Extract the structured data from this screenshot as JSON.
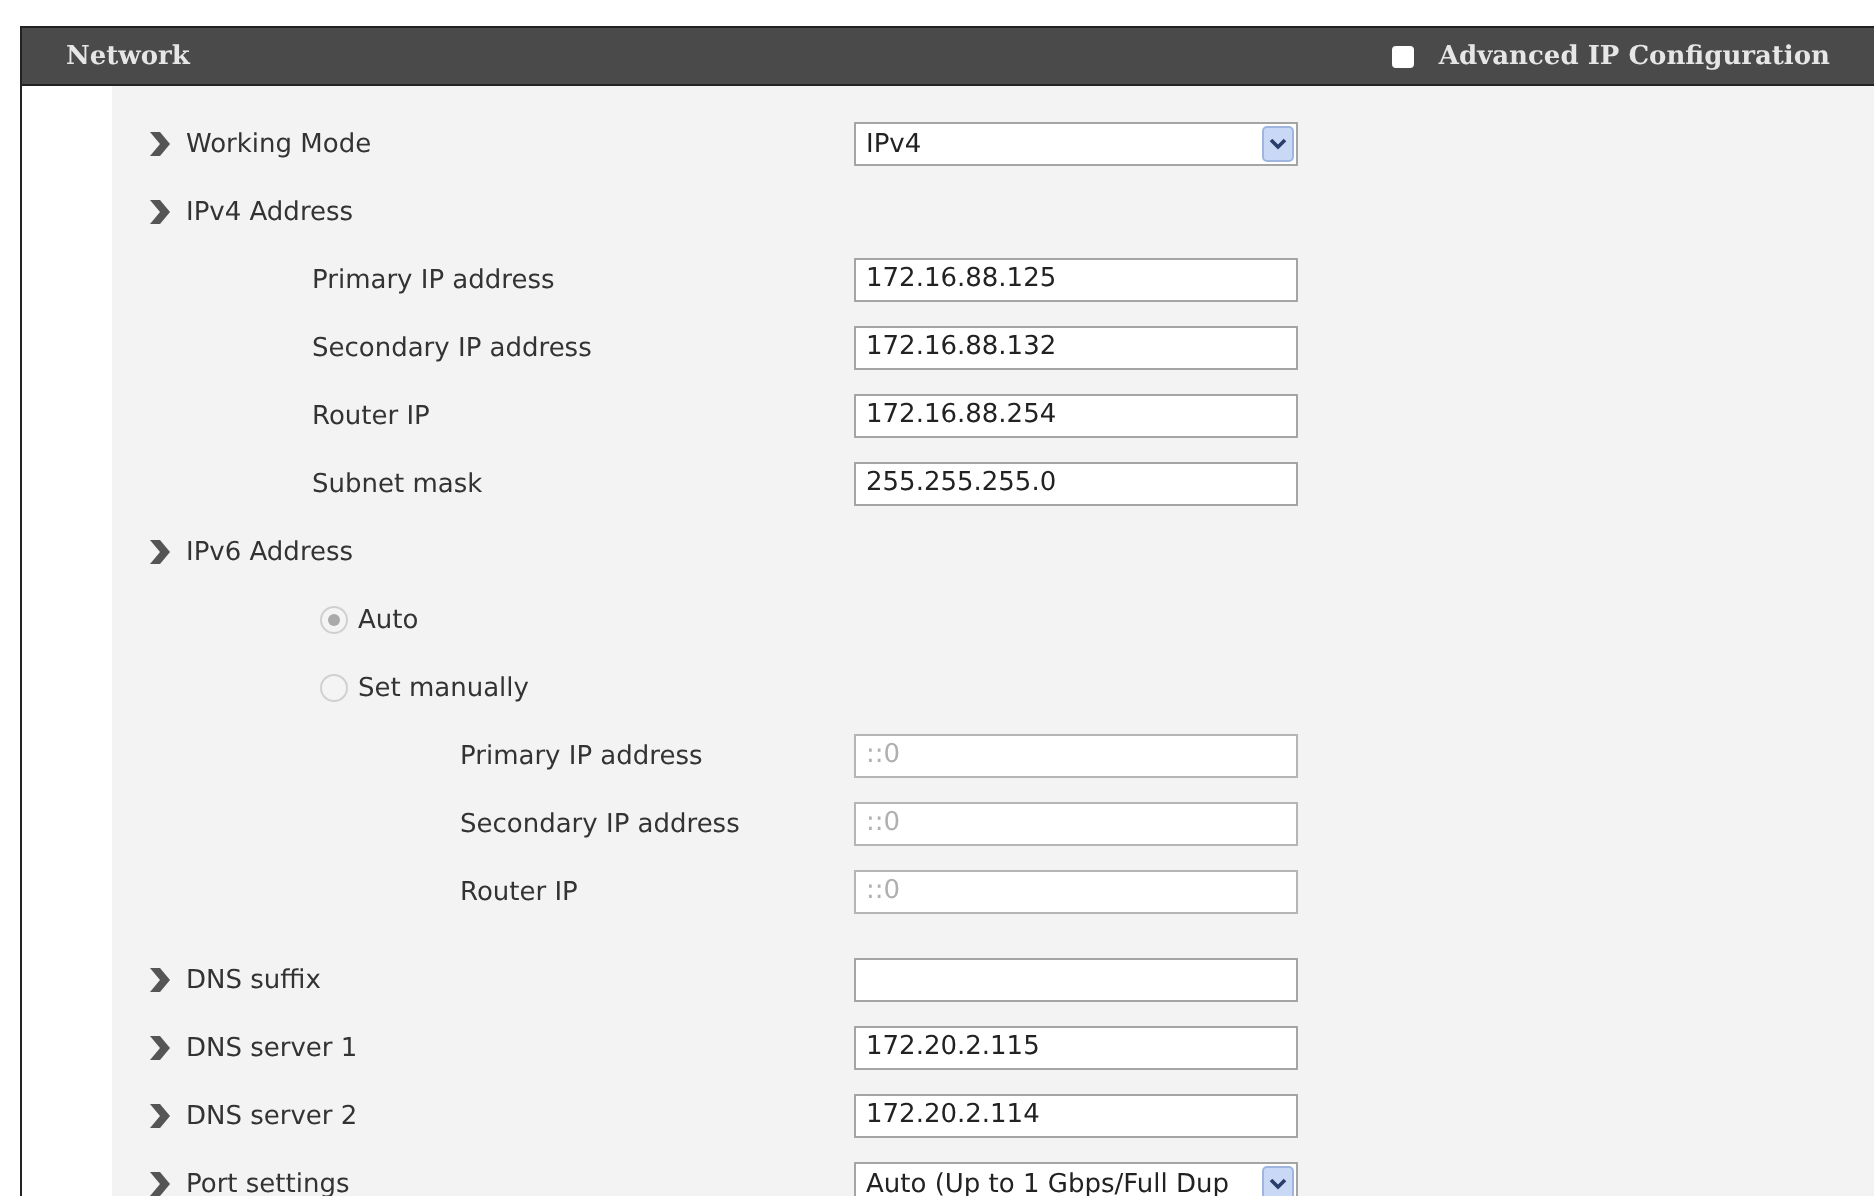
{
  "header": {
    "title": "Network",
    "advanced": {
      "label": "Advanced IP Configuration",
      "checked": false
    }
  },
  "rows": [
    {
      "kind": "select",
      "label": "Working Mode",
      "value": "IPv4"
    },
    {
      "kind": "group",
      "label": "IPv4 Address",
      "children": [
        {
          "kind": "text",
          "label": "Primary IP address",
          "value": "172.16.88.125",
          "disabled": false
        },
        {
          "kind": "text",
          "label": "Secondary IP address",
          "value": "172.16.88.132",
          "disabled": false
        },
        {
          "kind": "text",
          "label": "Router IP",
          "value": "172.16.88.254",
          "disabled": false
        },
        {
          "kind": "text",
          "label": "Subnet mask",
          "value": "255.255.255.0",
          "disabled": false
        }
      ]
    },
    {
      "kind": "group",
      "label": "IPv6 Address",
      "children": [
        {
          "kind": "radio",
          "label": "Auto",
          "selected": true,
          "disabled": true
        },
        {
          "kind": "radio",
          "label": "Set manually",
          "selected": false,
          "disabled": true,
          "children": [
            {
              "kind": "text",
              "label": "Primary IP address",
              "value": "::0",
              "disabled": true
            },
            {
              "kind": "text",
              "label": "Secondary IP address",
              "value": "::0",
              "disabled": true
            },
            {
              "kind": "text",
              "label": "Router IP",
              "value": "::0",
              "disabled": true
            }
          ]
        }
      ]
    },
    {
      "kind": "text",
      "label": "DNS suffix",
      "disabled": false
    },
    {
      "kind": "text",
      "label": "DNS server 1",
      "value": "172.20.2.115",
      "disabled": false
    },
    {
      "kind": "text",
      "label": "DNS server 2",
      "value": "172.20.2.114",
      "disabled": false
    },
    {
      "kind": "select",
      "label": "Port settings",
      "value": "Auto (Up to 1 Gbps/Full Dup"
    }
  ]
}
